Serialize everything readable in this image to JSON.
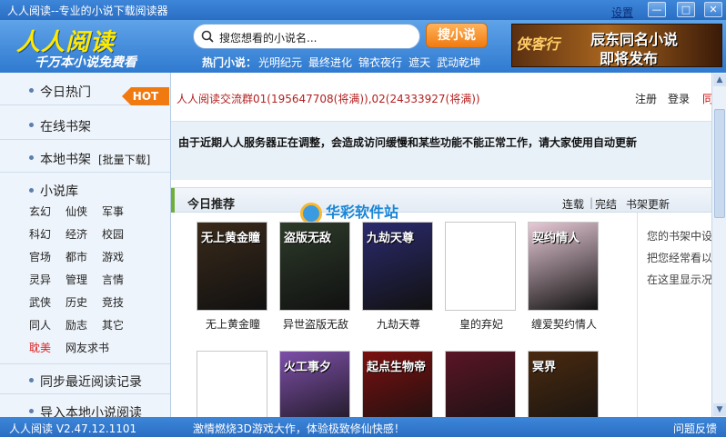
{
  "window": {
    "title": "人人阅读--专业的小说下载阅读器",
    "settings_label": "设置",
    "minimize_label": "—",
    "maximize_label": "□",
    "close_label": "✕"
  },
  "header": {
    "logo": "人人阅读",
    "slogan": "千万本小说免费看",
    "search_placeholder": "搜您想看的小说名...",
    "search_button": "搜小说",
    "hot_label": "热门小说：",
    "hot_keywords": [
      "光明纪元",
      "最终进化",
      "锦衣夜行",
      "遮天",
      "武动乾坤"
    ],
    "banner_left": "侠客行",
    "banner_line1": "辰东同名小说",
    "banner_line2": "即将发布"
  },
  "sidebar": {
    "today_hot": "今日热门",
    "hot_tag": "HOT",
    "online_shelf": "在线书架",
    "local_shelf": "本地书架",
    "batch_download": "[批量下载]",
    "library": "小说库",
    "categories": [
      "玄幻",
      "仙侠",
      "军事",
      "科幻",
      "经济",
      "校园",
      "官场",
      "都市",
      "游戏",
      "灵异",
      "管理",
      "言情",
      "武侠",
      "历史",
      "竞技",
      "同人",
      "励志",
      "其它",
      "耽美",
      "网友求书"
    ],
    "sync_records": "同步最近阅读记录",
    "import_local": "导入本地小说阅读"
  },
  "notice": {
    "qq_group": "人人阅读交流群01(195647708(将满)),02(24333927(将满))",
    "register": "注册",
    "login": "登录",
    "sync": "同"
  },
  "alert": {
    "text": "由于近期人人服务器正在调整，会造成访问缓慢和某些功能不能正常工作，请大家使用自动更新"
  },
  "recommend": {
    "title": "今日推荐",
    "filter_serial": "连载",
    "filter_separator": "|",
    "filter_complete": "完结",
    "shelf_update": "书架更新",
    "books": [
      {
        "name": "无上黄金瞳",
        "cover_title": "无上黄金瞳",
        "color": "#3a2a1a"
      },
      {
        "name": "异世盗版无敌",
        "cover_title": "盗版无敌",
        "color": "#2d3b2a"
      },
      {
        "name": "九劫天尊",
        "cover_title": "九劫天尊",
        "color": "#2b2a6e"
      },
      {
        "name": "皇的弃妃",
        "cover_title": "",
        "color": "#ffffff"
      },
      {
        "name": "缠爱契约情人",
        "cover_title": "契约情人",
        "color": "#e7c9d6"
      },
      {
        "name": "",
        "cover_title": "",
        "color": "#ffffff"
      },
      {
        "name": "",
        "cover_title": "火工事夕",
        "color": "#7d4fa8"
      },
      {
        "name": "",
        "cover_title": "起点生物帝",
        "color": "#7a1010"
      },
      {
        "name": "",
        "cover_title": "",
        "color": "#5a1525"
      },
      {
        "name": "",
        "cover_title": "冥界",
        "color": "#4a2a10"
      }
    ],
    "watermark": "华彩软件站"
  },
  "right_panel": {
    "hint": "您的书架中设把您经常看以在这里显示况"
  },
  "statusbar": {
    "version": "人人阅读 V2.47.12.1101",
    "ad": "激情燃烧3D游戏大作，体验极致修仙快感！",
    "feedback": "问题反馈"
  },
  "colors": {
    "title_blue": "#2a6ec4",
    "logo_yellow": "#ffe900",
    "accent_orange": "#f07a10",
    "alert_bg": "#e8f0f8",
    "link_red": "#b32020"
  }
}
